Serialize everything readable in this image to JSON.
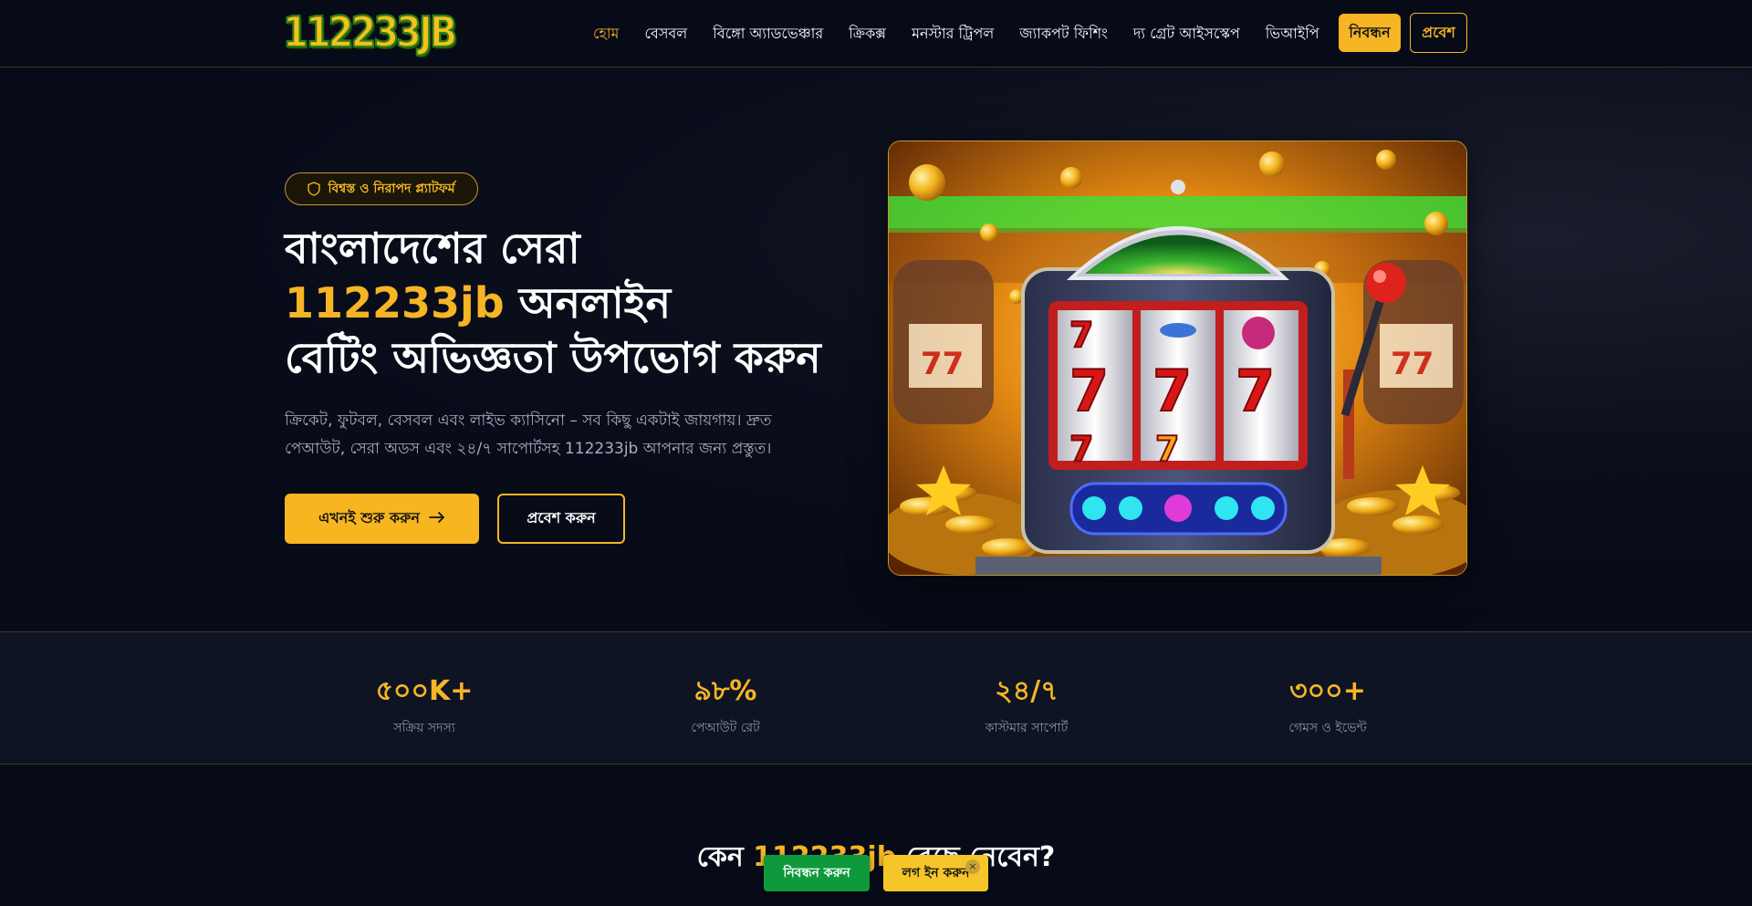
{
  "brand": {
    "logo_text": "112233JB"
  },
  "nav": {
    "links": [
      {
        "label": "হোম",
        "active": true
      },
      {
        "label": "বেসবল",
        "active": false
      },
      {
        "label": "বিঙ্গো অ্যাডভেঞ্চার",
        "active": false
      },
      {
        "label": "ক্রিকক্স",
        "active": false
      },
      {
        "label": "মনস্টার ট্রিপল",
        "active": false
      },
      {
        "label": "জ্যাকপট ফিশিং",
        "active": false
      },
      {
        "label": "দ্য গ্রেট আইসস্কেপ",
        "active": false
      },
      {
        "label": "ভিআইপি",
        "active": false
      }
    ],
    "register_label": "নিবন্ধন",
    "login_label": "প্রবেশ"
  },
  "hero": {
    "badge": "বিশ্বস্ত ও নিরাপদ প্ল্যাটফর্ম",
    "title_line1": "বাংলাদেশের সেরা",
    "title_accent": "112233jb",
    "title_line2_rest": " অনলাইন",
    "title_line3": "বেটিং অভিজ্ঞতা উপভোগ করুন",
    "subtitle": "ক্রিকেট, ফুটবল, বেসবল এবং লাইভ ক্যাসিনো – সব কিছু একটাই জায়গায়। দ্রুত পেআউট, সেরা অডস এবং ২৪/৭ সাপোর্টসহ 112233jb আপনার জন্য প্রস্তুত।",
    "start_button": "এখনই শুরু করুন",
    "enter_button": "প্রবেশ করুন"
  },
  "stats": [
    {
      "value": "৫০০K+",
      "label": "সক্রিয় সদস্য"
    },
    {
      "value": "৯৮%",
      "label": "পেআউট রেট"
    },
    {
      "value": "২৪/৭",
      "label": "কাস্টমার সাপোর্ট"
    },
    {
      "value": "৩০০+",
      "label": "গেমস ও ইভেন্ট"
    }
  ],
  "why": {
    "prefix": "কেন ",
    "accent": "112233jb",
    "suffix": " বেছে নেবেন?"
  },
  "floating": {
    "register_label": "নিবন্ধন করুন",
    "login_label": "লগ ইন করুন",
    "close_glyph": "×"
  },
  "colors": {
    "accent": "#f5b524",
    "background": "#070b18",
    "register_green": "#0e9a3c"
  }
}
